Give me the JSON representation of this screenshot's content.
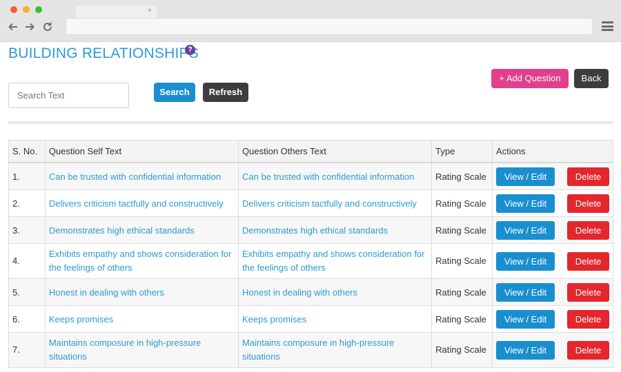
{
  "page": {
    "title": "BUILDING RELATIONSHIPS",
    "help": "?"
  },
  "toolbar": {
    "search_placeholder": "Search Text",
    "search_label": "Search",
    "refresh_label": "Refresh",
    "add_label": "+ Add Question",
    "back_label": "Back"
  },
  "browser": {
    "tab_close": "×"
  },
  "colors": {
    "accent": "#2c9ad1",
    "primary_button": "#1a8fd0",
    "dark_button": "#3d3d3d",
    "add_button": "#e23f8d",
    "delete_button": "#e4262d",
    "help_icon": "#6a3f98"
  },
  "table": {
    "headers": [
      "S. No.",
      "Question Self Text",
      "Question Others Text",
      "Type",
      "Actions"
    ],
    "action_labels": {
      "view": "View / Edit",
      "delete": "Delete"
    },
    "rows": [
      {
        "sno": "1.",
        "self": "Can be trusted with confidential information",
        "others": "Can be trusted with confidential information",
        "type": "Rating Scale"
      },
      {
        "sno": "2.",
        "self": "Delivers criticism tactfully and constructively",
        "others": "Delivers criticism tactfully and constructively",
        "type": "Rating Scale"
      },
      {
        "sno": "3.",
        "self": "Demonstrates high ethical standards",
        "others": "Demonstrates high ethical standards",
        "type": "Rating Scale"
      },
      {
        "sno": "4.",
        "self": "Exhibits empathy and shows consideration for the feelings of others",
        "others": "Exhibits empathy and shows consideration for the feelings of others",
        "type": "Rating Scale"
      },
      {
        "sno": "5.",
        "self": "Honest in dealing with others",
        "others": "Honest in dealing with others",
        "type": "Rating Scale"
      },
      {
        "sno": "6.",
        "self": "Keeps promises",
        "others": "Keeps promises",
        "type": "Rating Scale"
      },
      {
        "sno": "7.",
        "self": "Maintains composure in high-pressure situations",
        "others": "Maintains composure in high-pressure situations",
        "type": "Rating Scale"
      }
    ]
  }
}
